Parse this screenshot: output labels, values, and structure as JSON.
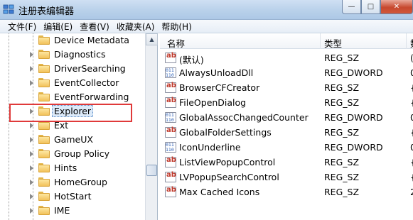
{
  "window": {
    "title": "注册表编辑器",
    "buttons": {
      "minimize": "—",
      "maximize": "□",
      "close": "✕"
    }
  },
  "menu": [
    {
      "label": "文件(F)"
    },
    {
      "label": "编辑(E)"
    },
    {
      "label": "查看(V)"
    },
    {
      "label": "收藏夹(A)"
    },
    {
      "label": "帮助(H)"
    }
  ],
  "tree": {
    "items": [
      {
        "label": "Device Metadata",
        "expandable": false
      },
      {
        "label": "Diagnostics",
        "expandable": true
      },
      {
        "label": "DriverSearching",
        "expandable": true
      },
      {
        "label": "EventCollector",
        "expandable": true
      },
      {
        "label": "EventForwarding",
        "expandable": false
      },
      {
        "label": "Explorer",
        "expandable": true,
        "selected": true
      },
      {
        "label": "Ext",
        "expandable": true
      },
      {
        "label": "GameUX",
        "expandable": true
      },
      {
        "label": "Group Policy",
        "expandable": true
      },
      {
        "label": "Hints",
        "expandable": true
      },
      {
        "label": "HomeGroup",
        "expandable": true
      },
      {
        "label": "HotStart",
        "expandable": true
      },
      {
        "label": "IME",
        "expandable": true
      }
    ]
  },
  "list": {
    "columns": {
      "name": "名称",
      "type": "类型",
      "data": "数"
    },
    "rows": [
      {
        "name": "(默认)",
        "type": "REG_SZ",
        "data": "(",
        "kind": "sz"
      },
      {
        "name": "AlwaysUnloadDll",
        "type": "REG_DWORD",
        "data": "0",
        "kind": "dw"
      },
      {
        "name": "BrowserCFCreator",
        "type": "REG_SZ",
        "data": "{",
        "kind": "sz"
      },
      {
        "name": "FileOpenDialog",
        "type": "REG_SZ",
        "data": "{",
        "kind": "sz"
      },
      {
        "name": "GlobalAssocChangedCounter",
        "type": "REG_DWORD",
        "data": "0",
        "kind": "dw"
      },
      {
        "name": "GlobalFolderSettings",
        "type": "REG_SZ",
        "data": "{",
        "kind": "sz"
      },
      {
        "name": "IconUnderline",
        "type": "REG_DWORD",
        "data": "0",
        "kind": "dw"
      },
      {
        "name": "ListViewPopupControl",
        "type": "REG_SZ",
        "data": "{",
        "kind": "sz"
      },
      {
        "name": "LVPopupSearchControl",
        "type": "REG_SZ",
        "data": "{",
        "kind": "sz"
      },
      {
        "name": "Max Cached Icons",
        "type": "REG_SZ",
        "data": "2",
        "kind": "sz"
      }
    ]
  }
}
